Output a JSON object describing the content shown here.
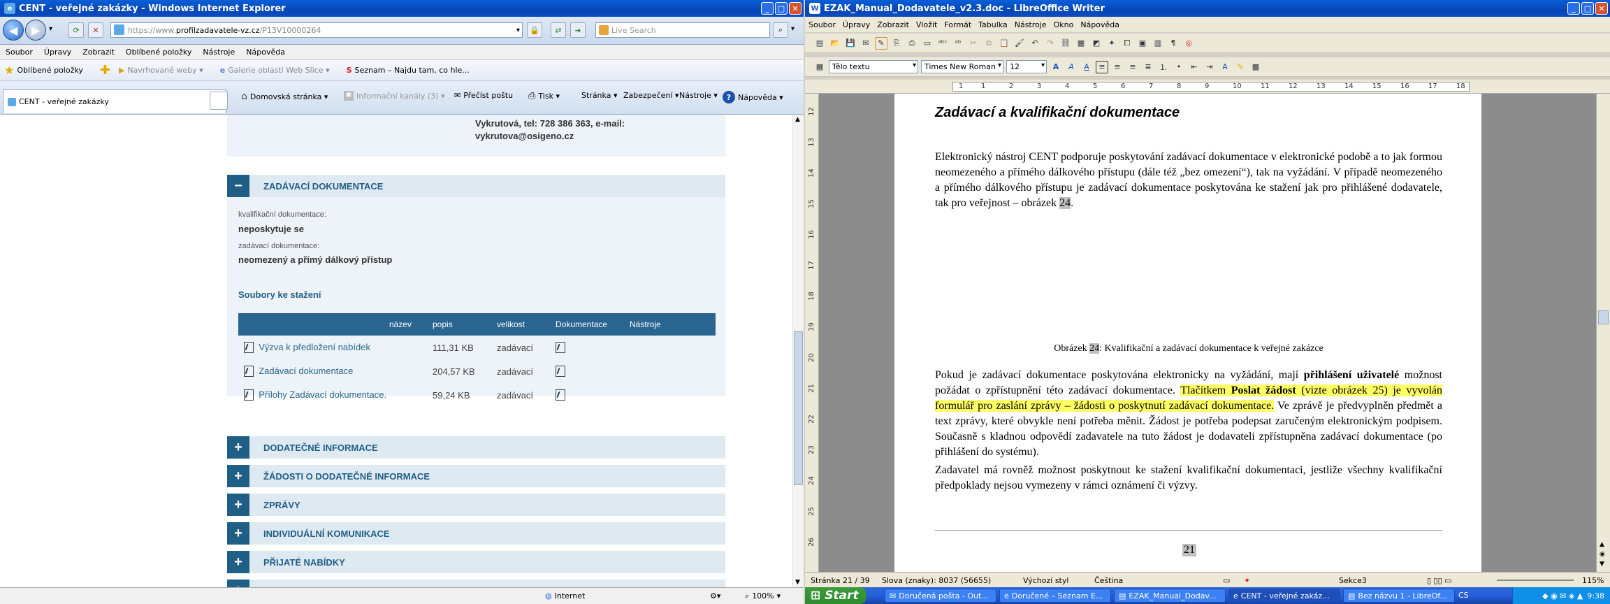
{
  "ie": {
    "title": "CENT - veřejné zakázky - Windows Internet Explorer",
    "url_prefix": "https://www.",
    "url_main": "profilzadavatele-vz.cz",
    "url_suffix": "/P13V10000264",
    "search_placeholder": "Live Search",
    "menu": [
      "Soubor",
      "Úpravy",
      "Zobrazit",
      "Oblíbené položky",
      "Nástroje",
      "Nápověda"
    ],
    "favorites_label": "Oblíbené položky",
    "fav_links": [
      "Navrhované weby ▾",
      "Galerie oblastí Web Slice ▾",
      "Seznam – Najdu tam, co hle..."
    ],
    "tab_label": "CENT - veřejné zakázky",
    "commands": [
      "Domovská stránka ▾",
      "Informační kanály (3) ▾",
      "Přečíst poštu",
      "Tisk ▾",
      "Stránka ▾",
      "Zabezpečení ▾",
      "Nástroje ▾",
      "Nápověda ▾"
    ],
    "status_zone": "Internet",
    "zoom": "100%"
  },
  "page": {
    "contact_line1": "Vykrutová, tel: 728 386 363, e-mail:",
    "contact_line2": "vykrutova@osigeno.cz",
    "section_open": "ZADÁVACÍ DOKUMENTACE",
    "kval_label": "kvalifikační dokumentace:",
    "kval_value": "neposkytuje se",
    "zad_label": "zadávací dokumentace:",
    "zad_value": "neomezený a přímý dálkový přístup",
    "files_heading": "Soubory ke stažení",
    "table_headers": [
      "název",
      "popis",
      "velikost",
      "Dokumentace",
      "Nástroje"
    ],
    "files": [
      {
        "name": "Výzva k předložení nabídek",
        "size": "111,31 KB",
        "type": "zadávací"
      },
      {
        "name": "Zadávací dokumentace",
        "size": "204,57 KB",
        "type": "zadávací"
      },
      {
        "name": "Přílohy Zadávací dokumentace.",
        "size": "59,24 KB",
        "type": "zadávací"
      }
    ],
    "collapsed_sections": [
      "DODATEČNÉ INFORMACE",
      "ŽÁDOSTI O DODATEČNÉ INFORMACE",
      "ZPRÁVY",
      "INDIVIDUÁLNÍ KOMUNIKACE",
      "PŘIJATÉ NABÍDKY"
    ]
  },
  "lo": {
    "title": "EZAK_Manual_Dodavatele_v2.3.doc - LibreOffice Writer",
    "menu": [
      "Soubor",
      "Úpravy",
      "Zobrazit",
      "Vložit",
      "Formát",
      "Tabulka",
      "Nástroje",
      "Okno",
      "Nápověda"
    ],
    "style": "Tělo textu",
    "font": "Times New Roman",
    "size": "12",
    "ruler_marks": [
      "1",
      "1",
      "2",
      "3",
      "4",
      "5",
      "6",
      "7",
      "8",
      "9",
      "10",
      "11",
      "12",
      "13",
      "14",
      "15",
      "16",
      "17",
      "18"
    ],
    "vruler_marks": [
      "12",
      "13",
      "14",
      "15",
      "16",
      "17",
      "18",
      "19",
      "20",
      "21",
      "22",
      "23",
      "24",
      "25",
      "26"
    ],
    "heading": "Zadávací a kvalifikační dokumentace",
    "para1": "Elektronický nástroj CENT podporuje poskytování zadávací dokumentace v elektronické podobě a to jak formou neomezeného a přímého dálkového přístupu (dále též „bez omezení“), tak na vyžádání. V případě neomezeného a přímého dálkového přístupu je zadávací dokumentace poskytována ke stažení jak pro přihlášené dodavatele, tak pro veřejnost – obrázek ",
    "para1_ref": "24",
    "caption_a": "Obrázek ",
    "caption_num": "24",
    "caption_b": ": Kvalifikační a zadávací dokumentace k veřejné zakázce",
    "p2_a": "Pokud je zadávací dokumentace poskytována elektronicky na vyžádání, mají ",
    "p2_b": "přihlášení uživatelé",
    "p2_c": " možnost požádat o zpřístupnění této zadávací dokumentace. ",
    "p2_d": "Tlačítkem ",
    "p2_e": "Poslat žádost",
    "p2_f": " (vizte obrázek 25) je vyvolán formulář pro zaslání zprávy – žádosti o poskytnutí zadávací dokumentace.",
    "p2_g": " Ve zprávě je předvyplněn předmět a text zprávy, které obvykle není potřeba měnit. Žádost je potřeba podepsat zaručeným elektronickým podpisem. Současně s kladnou odpovědí zadavatele na tuto žádost je dodavateli zpřístupněna zadávací dokumentace (po přihlášení do systému).",
    "para3": "Zadavatel má rovněž možnost poskytnout ke stažení kvalifikační dokumentaci, jestliže všechny kvalifikační předpoklady nejsou vymezeny v rámci oznámení či výzvy.",
    "page_num": "21",
    "status": {
      "page": "Stránka 21 / 39",
      "words": "Slova (znaky): 8037 (56655)",
      "style": "Výchozí styl",
      "lang": "Čeština",
      "section": "Sekce3",
      "zoom": "115%"
    }
  },
  "taskbar": {
    "start": "Start",
    "tasks": [
      "Doručená pošta - Out...",
      "Doručené – Seznam E...",
      "EZAK_Manual_Dodav...",
      "CENT - veřejné zakáz...",
      "Bez názvu 1 - LibreOf..."
    ],
    "lang": "CS",
    "time": "9:38"
  },
  "colors": {
    "accent": "#1f5f86",
    "table_header": "#2a6591",
    "section_bg": "#dfe9f2",
    "highlight": "#ffff66"
  }
}
